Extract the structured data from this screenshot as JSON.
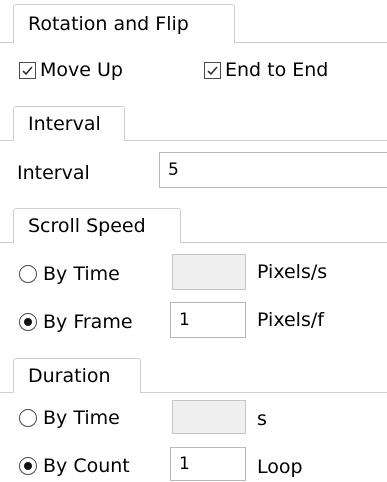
{
  "rotation": {
    "tab_label": "Rotation and Flip",
    "move_up": {
      "label": "Move Up",
      "checked": true
    },
    "end_to_end": {
      "label": "End to End",
      "checked": true
    }
  },
  "interval": {
    "tab_label": "Interval",
    "field_label": "Interval",
    "value": "5"
  },
  "scroll_speed": {
    "tab_label": "Scroll Speed",
    "by_time": {
      "label": "By Time",
      "selected": false,
      "value": "",
      "unit": "Pixels/s"
    },
    "by_frame": {
      "label": "By Frame",
      "selected": true,
      "value": "1",
      "unit": "Pixels/f"
    }
  },
  "duration": {
    "tab_label": "Duration",
    "by_time": {
      "label": "By Time",
      "selected": false,
      "value": "",
      "unit": "s"
    },
    "by_count": {
      "label": "By Count",
      "selected": true,
      "value": "1",
      "unit": "Loop"
    }
  }
}
